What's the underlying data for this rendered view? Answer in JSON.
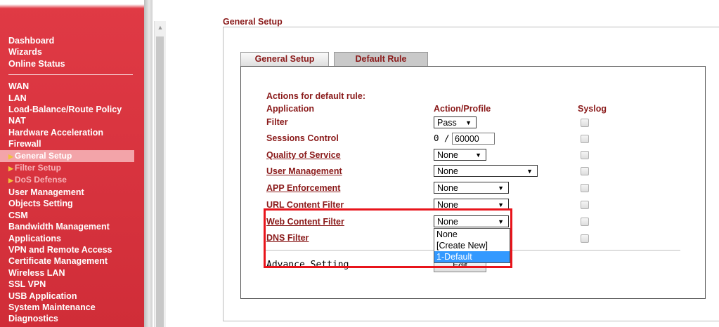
{
  "sidebar": {
    "group1": [
      "Dashboard",
      "Wizards",
      "Online Status"
    ],
    "group2": [
      "WAN",
      "LAN",
      "Load-Balance/Route Policy",
      "NAT",
      "Hardware Acceleration",
      "Firewall"
    ],
    "firewall_sub": [
      "General Setup",
      "Filter Setup",
      "DoS Defense"
    ],
    "group3": [
      "User Management",
      "Objects Setting",
      "CSM",
      "Bandwidth Management",
      "Applications",
      "VPN and Remote Access",
      "Certificate Management",
      "Wireless LAN",
      "SSL VPN",
      "USB Application",
      "System Maintenance",
      "Diagnostics"
    ]
  },
  "page_title": "General Setup",
  "tabs": {
    "general": "General Setup",
    "default": "Default Rule"
  },
  "section_title": "Actions for default rule:",
  "columns": {
    "application": "Application",
    "action": "Action/Profile",
    "syslog": "Syslog"
  },
  "rows": {
    "filter": {
      "label": "Filter",
      "value": "Pass"
    },
    "sessions": {
      "label": "Sessions Control",
      "current": "0 /",
      "limit": "60000"
    },
    "qos": {
      "label": "Quality of Service",
      "value": "None"
    },
    "user_mgmt": {
      "label": "User Management",
      "value": "None"
    },
    "app_enf": {
      "label": "APP Enforcement",
      "value": "None"
    },
    "url_filter": {
      "label": "URL Content Filter",
      "value": "None"
    },
    "web_filter": {
      "label": "Web Content Filter",
      "value": "None"
    },
    "dns_filter": {
      "label": "DNS Filter"
    }
  },
  "dropdown_options": [
    "None",
    "[Create New]",
    "1-Default"
  ],
  "advance": {
    "label": "Advance Setting",
    "button": "Edit"
  },
  "colors": {
    "sidebar": "#d8323d",
    "label": "#8a1a1a",
    "highlight": "#e8141b",
    "selected_option": "#3399ff"
  }
}
